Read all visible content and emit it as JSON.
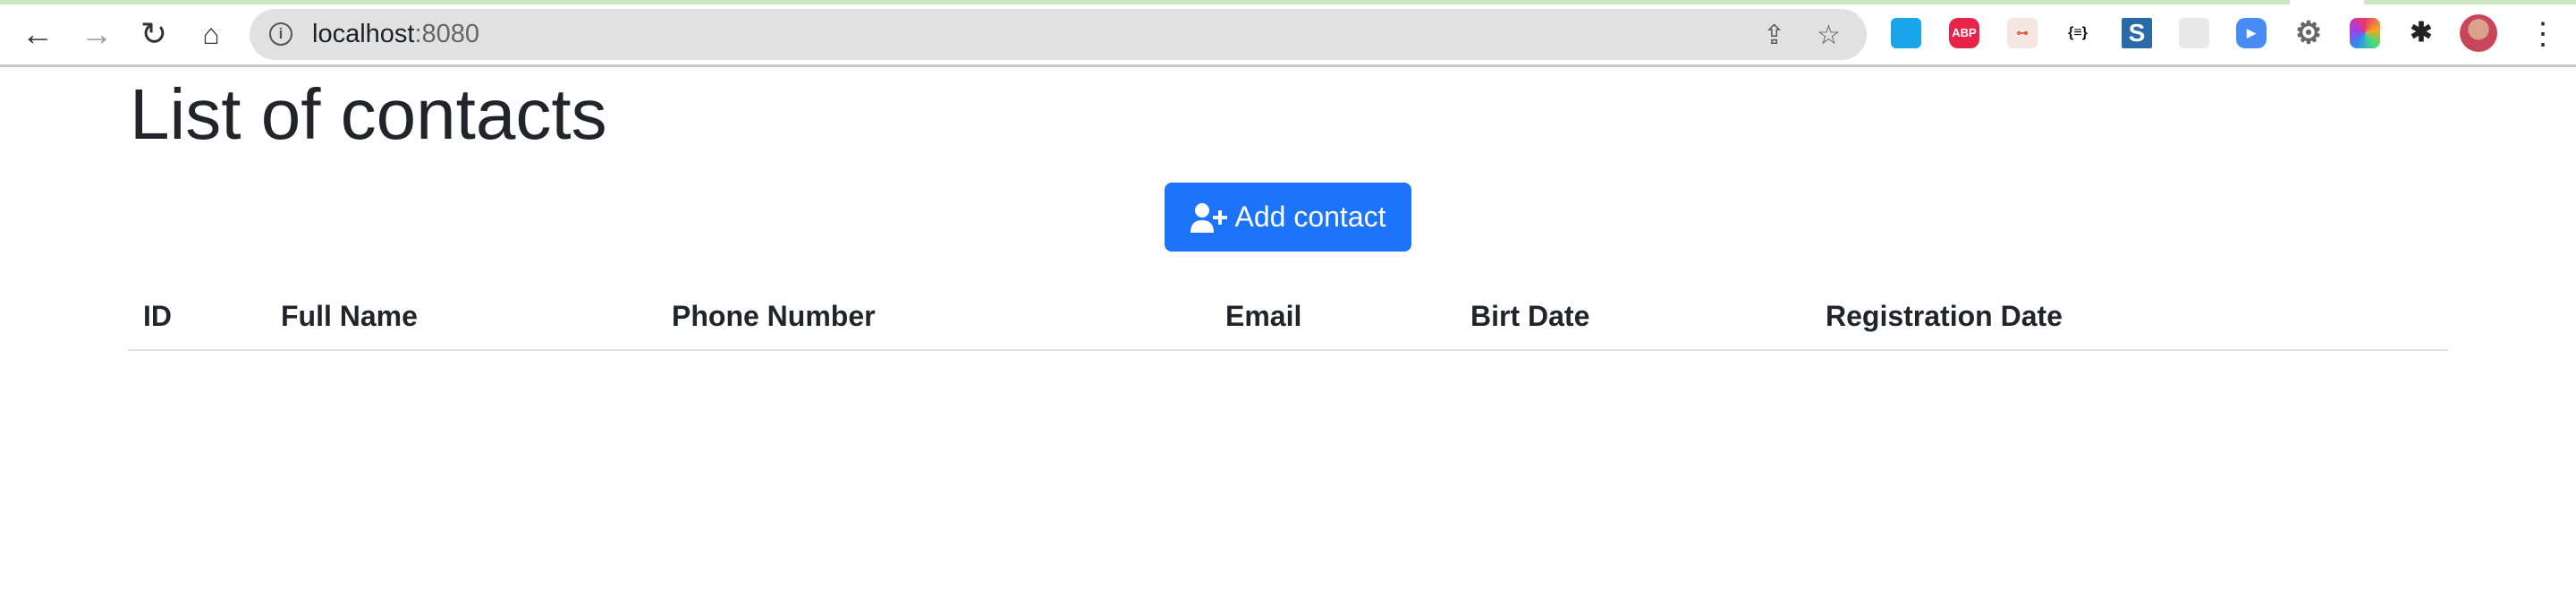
{
  "browser": {
    "url_host": "localhost",
    "url_port": ":8080",
    "extensions": [
      "tab-extension",
      "adblock-plus",
      "sitemap-extension",
      "json-formatter",
      "s-extension",
      "doc-extension",
      "zoom-extension",
      "settings-extension",
      "color-extension",
      "extensions-puzzle"
    ],
    "adblock_label": "ABP",
    "json_label": "{≡}",
    "s_label": "S"
  },
  "page": {
    "title": "List of contacts",
    "add_button_label": "Add contact",
    "accent_color": "#1c74fc"
  },
  "table": {
    "columns": [
      "ID",
      "Full Name",
      "Phone Number",
      "Email",
      "Birt Date",
      "Registration Date"
    ],
    "rows": []
  }
}
